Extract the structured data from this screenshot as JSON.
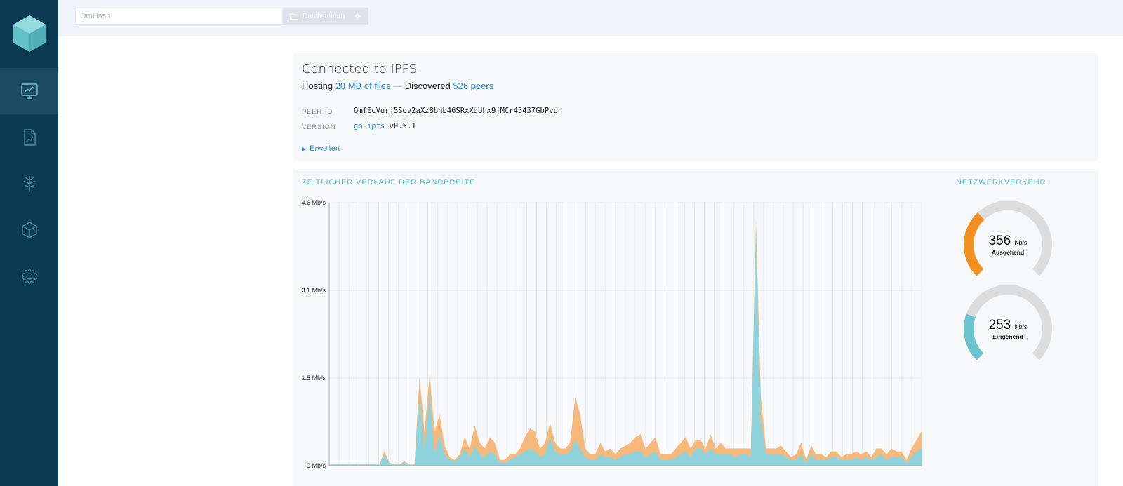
{
  "sidebar": {
    "items": [
      {
        "name": "status",
        "icon": "monitor-chart-icon",
        "active": true
      },
      {
        "name": "files",
        "icon": "document-icon",
        "active": false
      },
      {
        "name": "explore",
        "icon": "ipld-tree-icon",
        "active": false
      },
      {
        "name": "peers",
        "icon": "cube-icon",
        "active": false
      },
      {
        "name": "settings",
        "icon": "gear-icon",
        "active": false
      }
    ]
  },
  "search": {
    "placeholder": "QmHash",
    "browse_label": "Durchstöbern"
  },
  "connection": {
    "title": "Connected to IPFS",
    "hosting_prefix": "Hosting",
    "hosting_link": "20 MB of files",
    "separator": "—",
    "discovered_prefix": "Discovered",
    "discovered_link": "526 peers",
    "peer_id_label": "PEER-ID",
    "peer_id": "QmfEcVurj5Sov2aXz8bnb46SRxXdUhx9jMCr45437GbPvo",
    "version_label": "VERSION",
    "version_impl": "go-ipfs",
    "version_number": "v0.5.1",
    "advanced_label": "Erweitert"
  },
  "bandwidth": {
    "title": "ZEITLICHER VERLAUF DER BANDBREITE",
    "traffic_title": "NETZWERKVERKEHR",
    "outgoing": {
      "value": "356",
      "unit": "Kb/s",
      "label": "Ausgehend",
      "fraction": 0.34,
      "color": "#f39021"
    },
    "incoming": {
      "value": "253",
      "unit": "Kb/s",
      "label": "Eingehend",
      "fraction": 0.24,
      "color": "#69c4cd"
    }
  },
  "chart_data": {
    "type": "area",
    "yticks": [
      "4.6 Mb/s",
      "3.1 Mb/s",
      "1.5 Mb/s",
      "0 Mb/s"
    ],
    "ylim": [
      0,
      4.6
    ],
    "series": [
      {
        "color": "#f7b97b",
        "values": [
          0.02,
          0.02,
          0.02,
          0.02,
          0.02,
          0.02,
          0.02,
          0.02,
          0.02,
          0.02,
          0.02,
          0.25,
          0.05,
          0.02,
          0.02,
          0.08,
          0.02,
          0.02,
          1.55,
          0.6,
          1.6,
          0.6,
          0.9,
          0.35,
          0.15,
          0.1,
          0.2,
          0.5,
          0.3,
          0.7,
          0.4,
          0.3,
          0.5,
          0.4,
          0.1,
          0.1,
          0.2,
          0.2,
          0.3,
          0.5,
          0.65,
          0.6,
          0.3,
          0.4,
          0.75,
          0.4,
          0.3,
          0.3,
          0.4,
          1.2,
          0.9,
          0.3,
          0.2,
          0.2,
          0.4,
          0.25,
          0.3,
          0.2,
          0.3,
          0.35,
          0.4,
          0.5,
          0.55,
          0.3,
          0.4,
          0.5,
          0.2,
          0.2,
          0.2,
          0.3,
          0.4,
          0.5,
          0.3,
          0.45,
          0.45,
          0.3,
          0.55,
          0.3,
          0.4,
          0.3,
          0.3,
          0.3,
          0.3,
          0.3,
          0.3,
          4.3,
          1.2,
          0.3,
          0.3,
          0.3,
          0.35,
          0.25,
          0.15,
          0.2,
          0.4,
          0.1,
          0.35,
          0.2,
          0.2,
          0.15,
          0.25,
          0.25,
          0.15,
          0.2,
          0.2,
          0.25,
          0.2,
          0.25,
          0.15,
          0.3,
          0.3,
          0.2,
          0.3,
          0.25,
          0.25,
          0.1,
          0.3,
          0.45,
          0.6
        ],
        "name": ""
      },
      {
        "color": "#8fd4dc",
        "values": [
          0.02,
          0.02,
          0.02,
          0.02,
          0.02,
          0.02,
          0.02,
          0.02,
          0.02,
          0.02,
          0.02,
          0.2,
          0.04,
          0.02,
          0.02,
          0.05,
          0.02,
          0.02,
          1.2,
          0.3,
          1.3,
          0.2,
          0.55,
          0.2,
          0.1,
          0.08,
          0.15,
          0.3,
          0.15,
          0.35,
          0.2,
          0.15,
          0.25,
          0.2,
          0.05,
          0.05,
          0.1,
          0.15,
          0.2,
          0.25,
          0.3,
          0.25,
          0.15,
          0.2,
          0.5,
          0.25,
          0.2,
          0.2,
          0.25,
          0.45,
          0.3,
          0.15,
          0.1,
          0.1,
          0.2,
          0.15,
          0.15,
          0.1,
          0.15,
          0.2,
          0.2,
          0.25,
          0.25,
          0.15,
          0.2,
          0.25,
          0.1,
          0.1,
          0.1,
          0.15,
          0.2,
          0.25,
          0.15,
          0.3,
          0.3,
          0.2,
          0.3,
          0.2,
          0.2,
          0.2,
          0.2,
          0.15,
          0.2,
          0.2,
          0.15,
          4.1,
          0.8,
          0.2,
          0.2,
          0.2,
          0.2,
          0.15,
          0.1,
          0.1,
          0.2,
          0.05,
          0.2,
          0.1,
          0.1,
          0.1,
          0.15,
          0.15,
          0.1,
          0.1,
          0.1,
          0.15,
          0.1,
          0.15,
          0.1,
          0.15,
          0.2,
          0.1,
          0.15,
          0.15,
          0.15,
          0.05,
          0.15,
          0.25,
          0.3
        ],
        "name": ""
      }
    ]
  }
}
